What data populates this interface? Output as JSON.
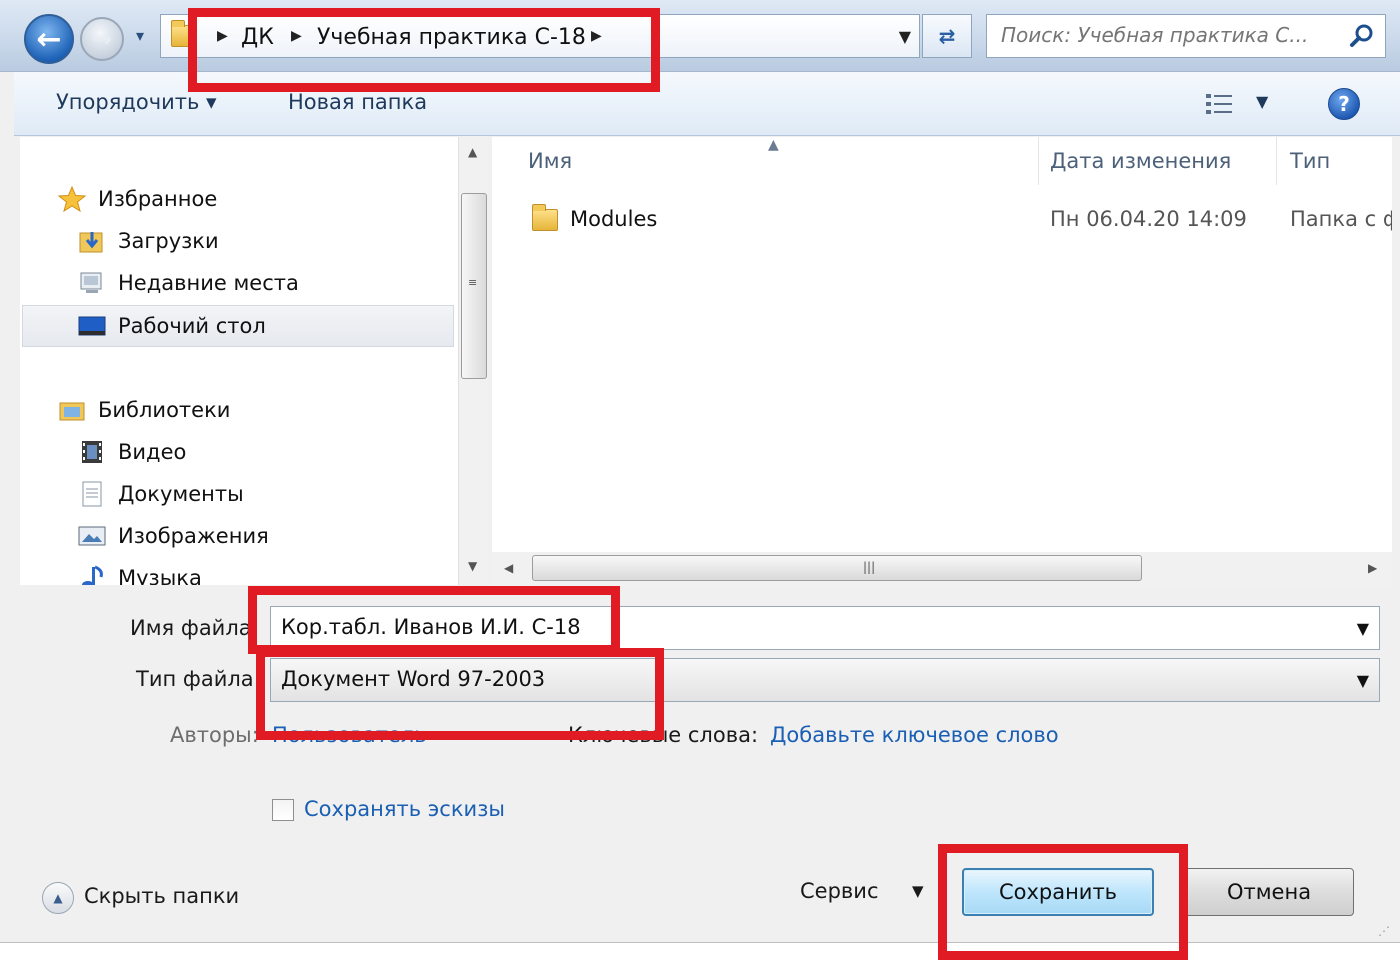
{
  "address_bar": {
    "crumbs": [
      "ДК",
      "Учебная практика С-18"
    ],
    "search_placeholder": "Поиск: Учебная практика С..."
  },
  "toolbar": {
    "organize_label": "Упорядочить ▾",
    "new_folder_label": "Новая папка"
  },
  "nav": {
    "favorites": "Избранное",
    "downloads": "Загрузки",
    "recent": "Недавние места",
    "desktop": "Рабочий стол",
    "libraries": "Библиотеки",
    "video": "Видео",
    "documents": "Документы",
    "images": "Изображения",
    "music": "Музыка"
  },
  "file_list": {
    "columns": [
      "Имя",
      "Дата изменения",
      "Тип"
    ],
    "rows": [
      {
        "name": "Modules",
        "date": "Пн 06.04.20 14:09",
        "type": "Папка с ф"
      }
    ]
  },
  "form": {
    "filename_label": "Имя файла:",
    "filename_value": "Кор.табл. Иванов И.И. С-18",
    "filetype_label": "Тип файла:",
    "filetype_value": "Документ Word 97-2003",
    "authors_label": "Авторы:",
    "authors_value": "Пользователь",
    "tags_label": "Ключевые слова:",
    "tags_value": "Добавьте ключевое слово",
    "thumbnails_label": "Сохранять эскизы",
    "thumbnails_checked": false
  },
  "footer": {
    "hide_folders_label": "Скрыть папки",
    "tools_label": "Сервис",
    "save_label": "Сохранить",
    "cancel_label": "Отмена"
  },
  "colors": {
    "annotation_red": "#e01b24",
    "link_blue": "#1a5fb4",
    "primary_button_border": "#3c7fb1"
  }
}
